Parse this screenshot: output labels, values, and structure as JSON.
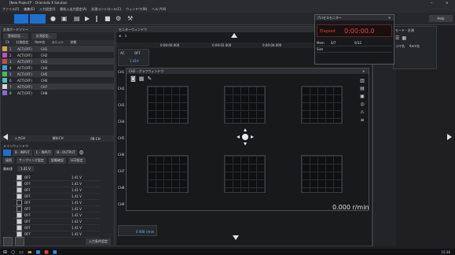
{
  "window": {
    "title": "[New Project]* - Orientalis X Solution"
  },
  "menu": [
    "ファイル(F)",
    "編集(E)",
    "入力設定(I)",
    "解析入出力設定(A)",
    "計測コントロール(C)",
    "ウィンドウ(W)",
    "ヘルプ(H)"
  ],
  "toolbar": {
    "help_label": "Help"
  },
  "left_panel": {
    "title": "計測ボードツリー",
    "tabs": [
      "登録設定...",
      "計測設定..."
    ],
    "columns": [
      "Ch",
      "計測設定",
      "Item名",
      "ユニット",
      "状態"
    ],
    "channels": [
      {
        "id": "1",
        "color": "#d9a441",
        "status": "ACT(OFF)",
        "name": "CH1"
      },
      {
        "id": "2",
        "color": "#c04fbf",
        "status": "ACT(OFF)",
        "name": "CH2"
      },
      {
        "id": "3",
        "color": "#c94a4a",
        "status": "ACT(OFF)",
        "name": "CH3"
      },
      {
        "id": "4",
        "color": "#3b9fd8",
        "status": "ACT(OFF)",
        "name": "CH4"
      },
      {
        "id": "5",
        "color": "#49b857",
        "status": "ACT(OFF)",
        "name": "CH5"
      },
      {
        "id": "6",
        "color": "#4bc2c2",
        "status": "ACT(OFF)",
        "name": "CH6"
      },
      {
        "id": "7",
        "color": "#d5d5d5",
        "status": "ACT(OFF)",
        "name": "CH7"
      },
      {
        "id": "8",
        "color": "#8a6ad8",
        "status": "ACT(OFF)",
        "name": "CH8"
      }
    ],
    "lower_tabs": [
      "入力CH",
      "解析CH",
      "PB CH"
    ],
    "lower_title": "メインウィンドウ",
    "lower_buttons": [
      "B - INPUT",
      "C - INPUT",
      "B - OUTPUT",
      "LED設定"
    ],
    "lower_row2": [
      "接続",
      "サンプリング設定",
      "設備確認"
    ],
    "detail_label": "最新値",
    "detail_value": "1.41 V",
    "list_rows": [
      {
        "on": true,
        "label": "OFF",
        "value": "1.41 V"
      },
      {
        "on": true,
        "label": "OFF",
        "value": "1.41 V"
      },
      {
        "on": true,
        "label": "OFF",
        "value": "1.41 V"
      },
      {
        "on": true,
        "label": "OFF",
        "value": "1.41 V"
      },
      {
        "on": false,
        "label": "OFF",
        "value": "1.41 V"
      },
      {
        "on": false,
        "label": "OFF",
        "value": "1.41 V"
      },
      {
        "on": true,
        "label": "OFF",
        "value": "1.41 V"
      },
      {
        "on": true,
        "label": "OFF",
        "value": "1.41 V"
      },
      {
        "on": true,
        "label": "OFF",
        "value": "1.41 V"
      },
      {
        "on": true,
        "label": "OFF",
        "value": "1.41 V"
      }
    ],
    "bottom_button": "入力条件設定"
  },
  "center": {
    "top_title": "モニターウィンドウ",
    "time_ticks": [
      "0:00:00.000",
      "0:00:02.000",
      "0:00:04.000"
    ],
    "side_labels": [
      "CH1",
      "CH2",
      "CH3",
      "CH4",
      "CH5",
      "CH6",
      "CH7",
      "CH8",
      "CH9"
    ],
    "value_box": [
      "1.41V",
      "AC",
      "OFF"
    ],
    "sub_title": "CH2 - グラフウィンドウ",
    "speed": "0.000 r/min",
    "bottom_readout": "0.000 r/min"
  },
  "stopwatch": {
    "title": "プロセスモニター",
    "elapsed_label": "Elapsed",
    "elapsed_value": "0:00:00.0",
    "rows": [
      {
        "label": "Mem",
        "col1": "0/7",
        "col2": "0/32"
      },
      {
        "label": "Size",
        "col1": "",
        "col2": ""
      }
    ]
  },
  "right_panel": {
    "title": "モード - 計測",
    "columns": [
      "コマ名",
      "Item名"
    ]
  },
  "taskbar": {
    "time": "15:36"
  }
}
